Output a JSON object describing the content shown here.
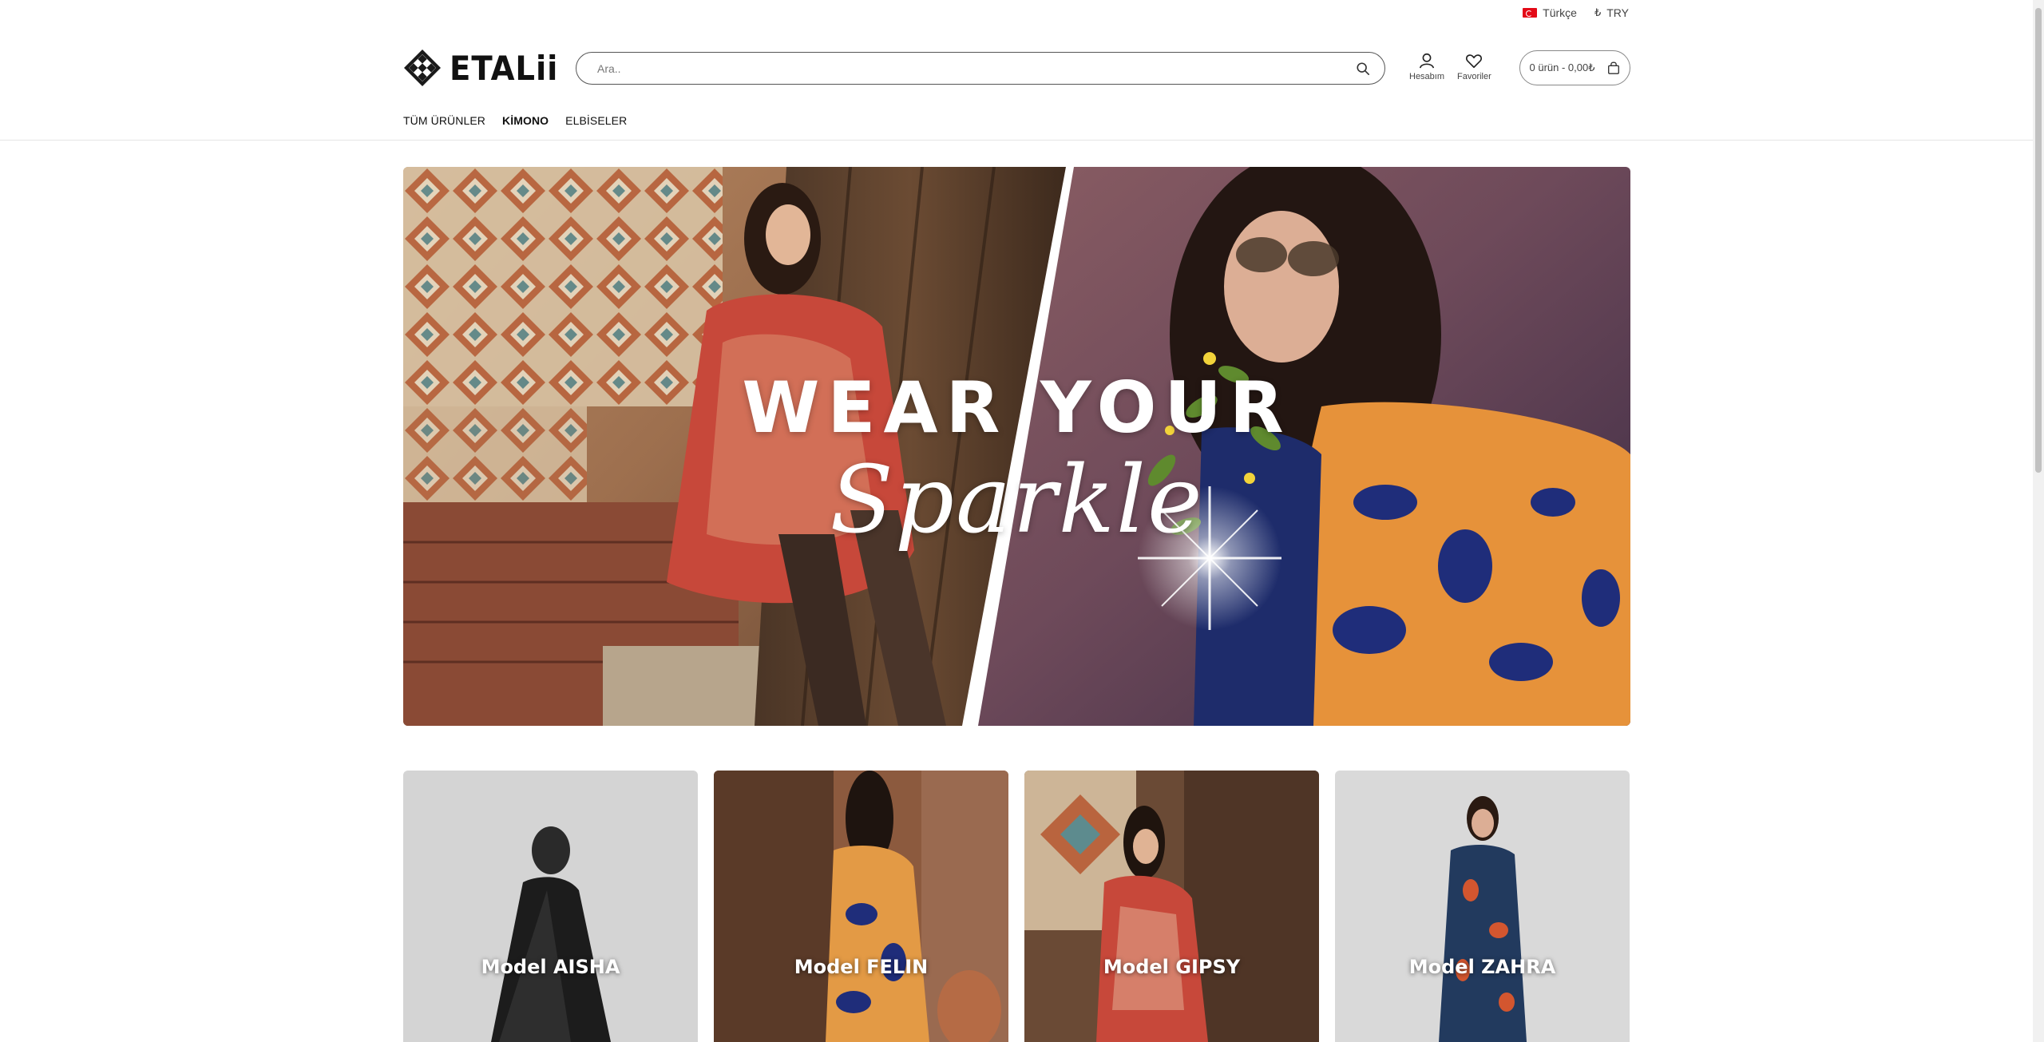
{
  "topbar": {
    "language": "Türkçe",
    "currency": "TRY",
    "currency_symbol": "₺"
  },
  "header": {
    "logo_text": "ETALii",
    "search_placeholder": "Ara..",
    "account_label": "Hesabım",
    "favorites_label": "Favoriler",
    "cart_label": "0 ürün - 0,00₺"
  },
  "nav": {
    "items": [
      {
        "label": "TÜM ÜRÜNLER"
      },
      {
        "label": "KİMONO"
      },
      {
        "label": "ELBİSELER"
      }
    ]
  },
  "hero": {
    "title": "WEAR YOUR",
    "script": "Sparkle"
  },
  "cards": [
    {
      "label": "Model AISHA"
    },
    {
      "label": "Model FELIN"
    },
    {
      "label": "Model GIPSY"
    },
    {
      "label": "Model ZAHRA"
    }
  ],
  "colors": {
    "accent": "#111111",
    "flag_red": "#e30a17",
    "border": "#555555"
  }
}
